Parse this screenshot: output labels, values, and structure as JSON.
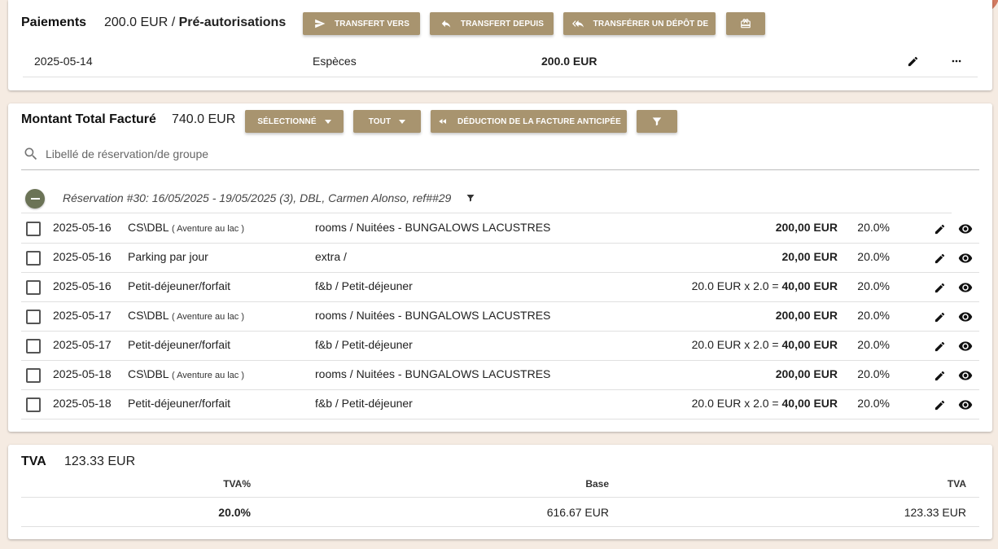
{
  "payments": {
    "title": "Paiements",
    "amount": "200.0 EUR",
    "separator": "/",
    "preauth_label": "Pré-autorisations",
    "buttons": {
      "transfer_to": "TRANSFERT VERS",
      "transfer_from": "TRANSFERT DEPUIS",
      "transfer_deposit": "TRANSFÉRER UN DÉPÔT DE"
    },
    "rows": [
      {
        "date": "2025-05-14",
        "method": "Espèces",
        "amount": "200.0 EUR"
      }
    ]
  },
  "billed": {
    "title": "Montant Total Facturé",
    "amount": "740.0 EUR",
    "buttons": {
      "selected": "SÉLECTIONNÉ",
      "all": "TOUT",
      "deduction": "DÉDUCTION DE LA FACTURE ANTICIPÉE"
    },
    "search_placeholder": "Libellé de réservation/de groupe",
    "reservation_label": "Réservation #30: 16/05/2025 - 19/05/2025 (3), DBL, Carmen Alonso, ref##29",
    "rows": [
      {
        "date": "2025-05-16",
        "item": "CS\\DBL",
        "note": "( Aventure au lac )",
        "category": "rooms / Nuitées - BUNGALOWS LACUSTRES",
        "calc": "",
        "amount": "200,00 EUR",
        "vat": "20.0%"
      },
      {
        "date": "2025-05-16",
        "item": "Parking par jour",
        "note": "",
        "category": "extra /",
        "calc": "",
        "amount": "20,00 EUR",
        "vat": "20.0%"
      },
      {
        "date": "2025-05-16",
        "item": "Petit-déjeuner/forfait",
        "note": "",
        "category": "f&b / Petit-déjeuner",
        "calc": "20.0 EUR x 2.0 =",
        "amount": "40,00 EUR",
        "vat": "20.0%"
      },
      {
        "date": "2025-05-17",
        "item": "CS\\DBL",
        "note": "( Aventure au lac )",
        "category": "rooms / Nuitées - BUNGALOWS LACUSTRES",
        "calc": "",
        "amount": "200,00 EUR",
        "vat": "20.0%"
      },
      {
        "date": "2025-05-17",
        "item": "Petit-déjeuner/forfait",
        "note": "",
        "category": "f&b / Petit-déjeuner",
        "calc": "20.0 EUR x 2.0 =",
        "amount": "40,00 EUR",
        "vat": "20.0%"
      },
      {
        "date": "2025-05-18",
        "item": "CS\\DBL",
        "note": "( Aventure au lac )",
        "category": "rooms / Nuitées - BUNGALOWS LACUSTRES",
        "calc": "",
        "amount": "200,00 EUR",
        "vat": "20.0%"
      },
      {
        "date": "2025-05-18",
        "item": "Petit-déjeuner/forfait",
        "note": "",
        "category": "f&b / Petit-déjeuner",
        "calc": "20.0 EUR x 2.0 =",
        "amount": "40,00 EUR",
        "vat": "20.0%"
      }
    ]
  },
  "vat": {
    "title": "TVA",
    "amount": "123.33 EUR",
    "headers": {
      "rate": "TVA%",
      "base": "Base",
      "vat": "TVA"
    },
    "rows": [
      {
        "rate": "20.0%",
        "base": "616.67 EUR",
        "vat": "123.33 EUR"
      }
    ]
  },
  "colors": {
    "background": "#f5ebe2",
    "button": "#a8946f",
    "collapse_button": "#6b7356",
    "top_circle_tan": "#b29f7f",
    "top_circle_olive": "#6f7a5a",
    "top_circle_terracotta": "#d27a60"
  },
  "icons": [
    "send-icon",
    "reply-icon",
    "reply-all-icon",
    "gift-card-icon",
    "pencil-icon",
    "more-horiz-icon",
    "funnel-icon",
    "rewind-icon",
    "search-icon",
    "minus-icon",
    "eye-icon"
  ]
}
